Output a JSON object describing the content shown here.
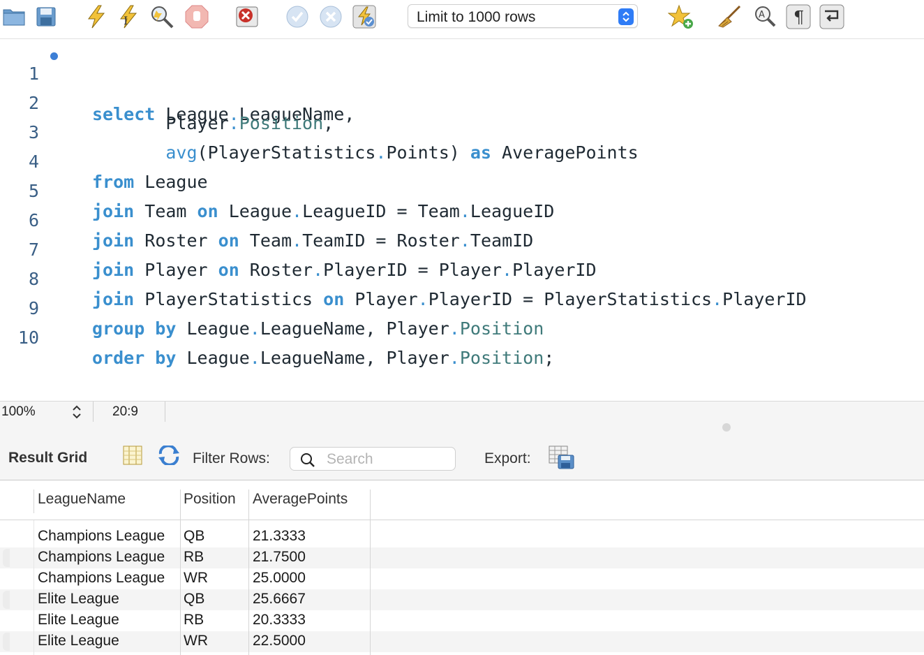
{
  "toolbar": {
    "icons": [
      "open-folder-icon",
      "save-icon",
      "execute-all-icon",
      "execute-current-icon",
      "explain-icon",
      "stop-icon",
      "error-stop-icon",
      "commit-icon",
      "rollback-icon",
      "autocommit-icon",
      "limit-select",
      "add-snippet-icon",
      "beautify-icon",
      "find-icon",
      "invisibles-icon",
      "wrap-icon"
    ],
    "limit_label": "Limit to 1000 rows",
    "accent": "#2f7cf6"
  },
  "editor": {
    "lines": [
      {
        "n": "1"
      },
      {
        "n": "2"
      },
      {
        "n": "3"
      },
      {
        "n": "4"
      },
      {
        "n": "5"
      },
      {
        "n": "6"
      },
      {
        "n": "7"
      },
      {
        "n": "8"
      },
      {
        "n": "9"
      },
      {
        "n": "10"
      }
    ],
    "keyword_color": "#3a8fce"
  },
  "status": {
    "zoom": "100%",
    "cursor": "20:9"
  },
  "result": {
    "title": "Result Grid",
    "filter_label": "Filter Rows:",
    "search_placeholder": "Search",
    "export_label": "Export:",
    "columns": [
      "LeagueName",
      "Position",
      "AveragePoints"
    ],
    "rows": [
      [
        "Champions League",
        "QB",
        "21.3333"
      ],
      [
        "Champions League",
        "RB",
        "21.7500"
      ],
      [
        "Champions League",
        "WR",
        "25.0000"
      ],
      [
        "Elite League",
        "QB",
        "25.6667"
      ],
      [
        "Elite League",
        "RB",
        "20.3333"
      ],
      [
        "Elite League",
        "WR",
        "22.5000"
      ]
    ]
  }
}
